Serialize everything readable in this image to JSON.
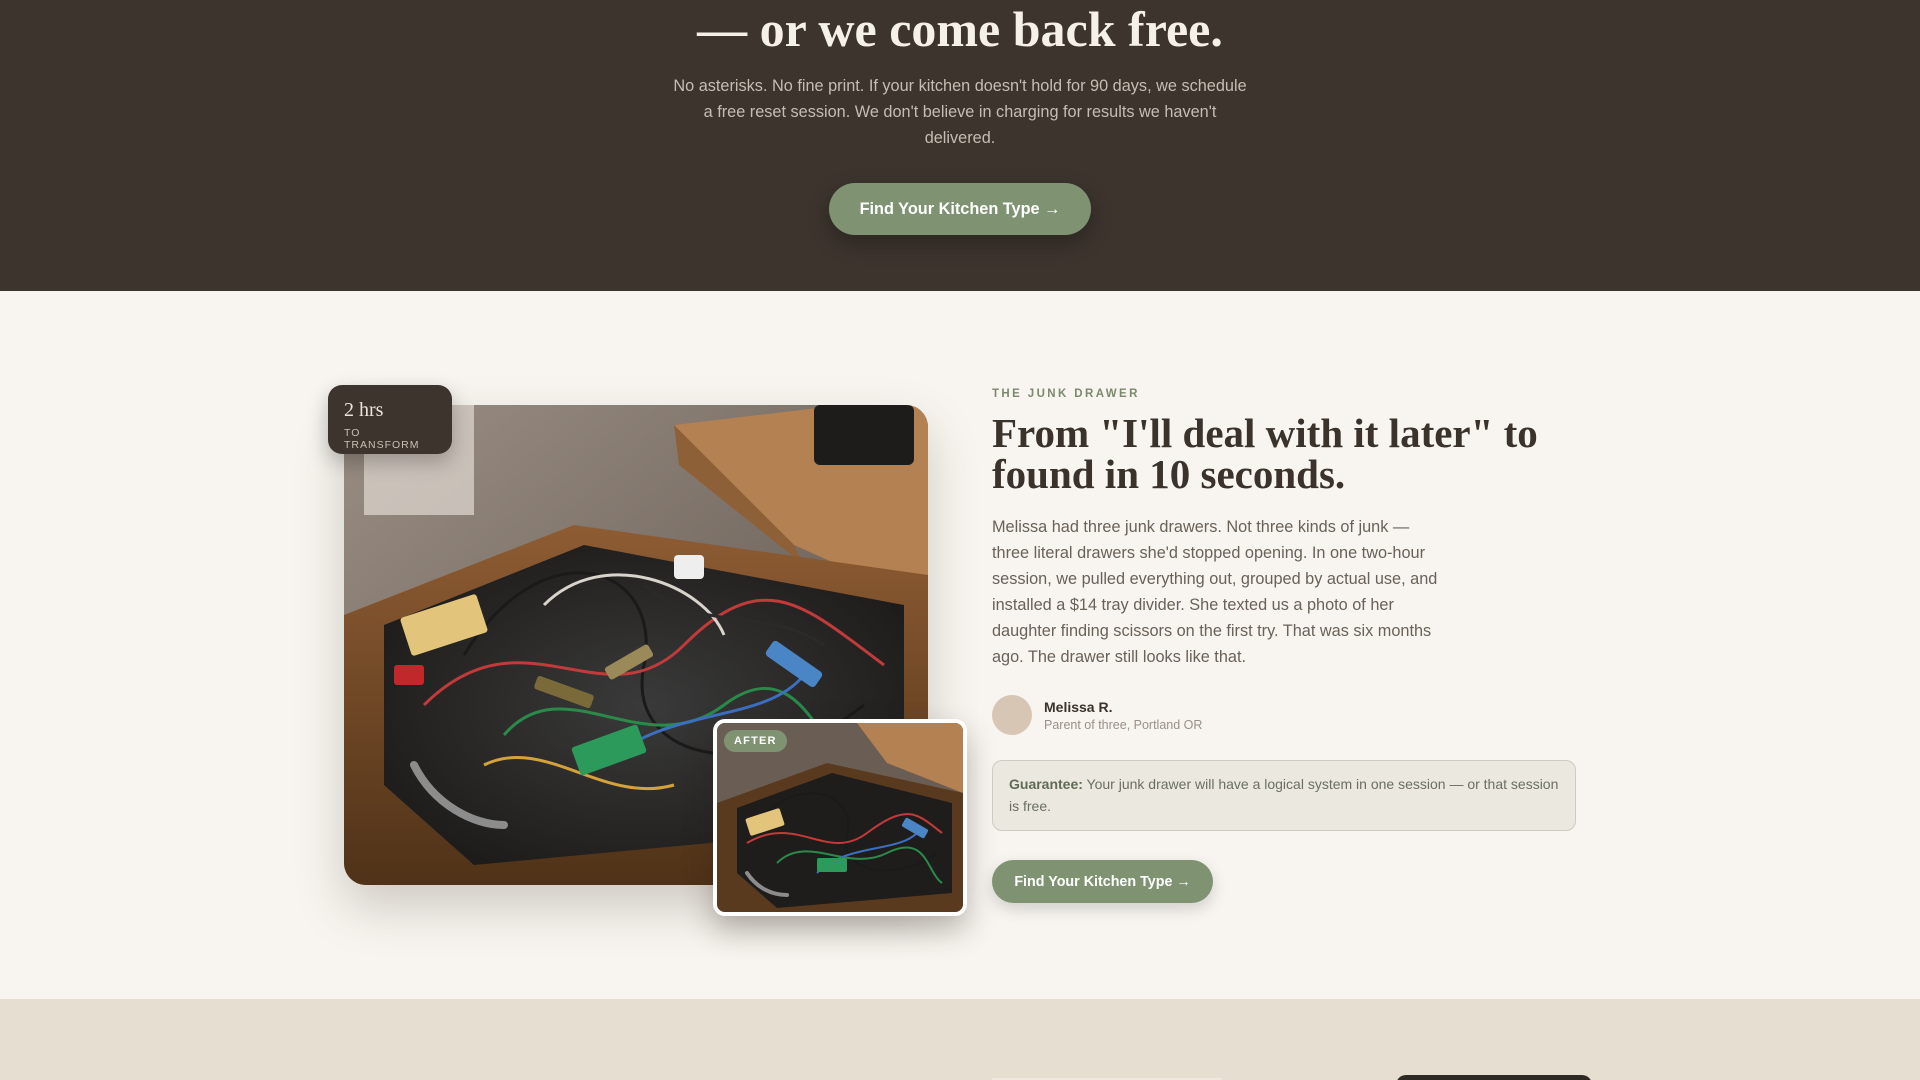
{
  "hero": {
    "title": "— or we come back free.",
    "subtitle": "No asterisks. No fine print. If your kitchen doesn't hold for 90 days, we schedule a free reset session. We don't believe in charging for results we haven't delivered.",
    "cta_label": "Find Your Kitchen Type →",
    "background_color": "#3c342d"
  },
  "story": {
    "badge": {
      "value": "2 hrs",
      "label": "TO TRANSFORM"
    },
    "after_label": "AFTER",
    "eyebrow": "THE JUNK DRAWER",
    "headline": "From \"I'll deal with it later\" to found in 10 seconds.",
    "body": "Melissa had three junk drawers. Not three kinds of junk — three literal drawers she'd stopped opening. In one two-hour session, we pulled everything out, grouped by actual use, and installed a $14 tray divider. She texted us a photo of her daughter finding scissors on the first try. That was six months ago. The drawer still looks like that.",
    "author": {
      "name": "Melissa R.",
      "meta": "Parent of three, Portland OR"
    },
    "guarantee": {
      "label": "Guarantee:",
      "text": " Your junk drawer will have a logical system in one session — or that session is free."
    },
    "cta_label": "Find Your Kitchen Type →"
  },
  "colors": {
    "accent": "#7f9373",
    "dark": "#3c342d",
    "cream": "#f8f5f0",
    "tan": "#e7ded2"
  }
}
